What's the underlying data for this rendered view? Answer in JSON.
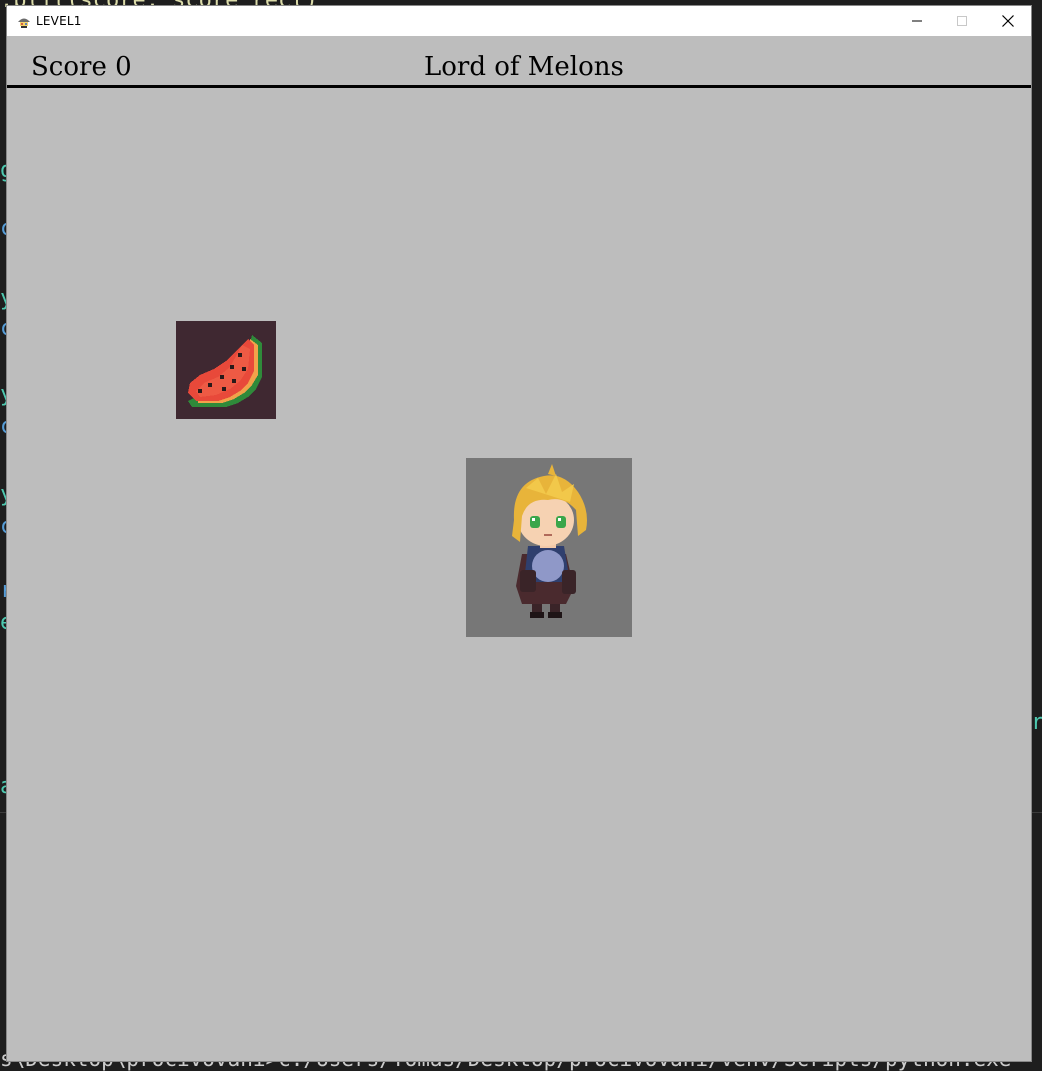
{
  "window": {
    "title": "LEVEL1",
    "app_icon": "pygame-icon",
    "controls": [
      "minimize-icon",
      "maximize-icon",
      "close-icon"
    ]
  },
  "hud": {
    "score_text": "Score 0",
    "game_title": "Lord of Melons"
  },
  "game": {
    "background_color": "#bdbdbd",
    "sprites": [
      {
        "name": "watermelon-slice",
        "tile_color": "#3f2831"
      },
      {
        "name": "player-character",
        "tile_color": "#777777",
        "hair_color": "#e8b43a",
        "eye_color": "#3aa64a"
      }
    ]
  },
  "background_editor": {
    "top_fragment": ".blit(score, score_rect)",
    "bottom_fragment": "s\\Desktop\\procivovani>c:/Users/Tomas/Desktop/procivovani/venv/Scripts/python.exe"
  }
}
